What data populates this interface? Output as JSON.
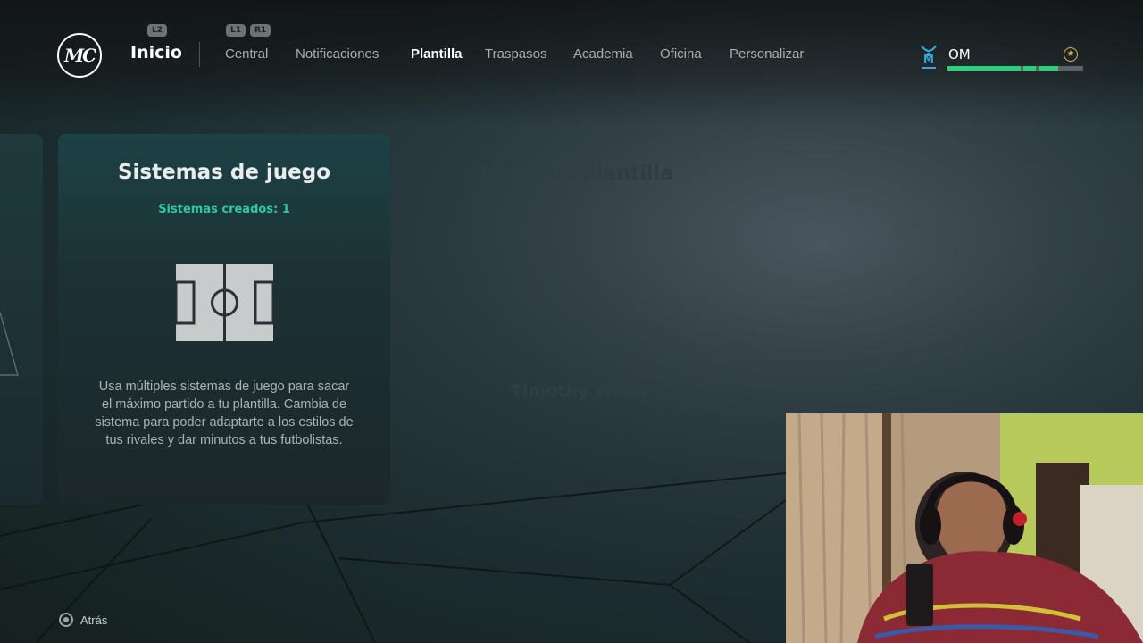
{
  "header": {
    "logo_text": "MC",
    "home_hint": "L2",
    "home_label": "Inicio",
    "tab_hints": [
      "L1",
      "R1"
    ],
    "tabs": [
      {
        "label": "Central",
        "active": false
      },
      {
        "label": "Notificaciones",
        "active": false
      },
      {
        "label": "Plantilla",
        "active": true
      },
      {
        "label": "Traspasos",
        "active": false
      },
      {
        "label": "Academia",
        "active": false
      },
      {
        "label": "Oficina",
        "active": false
      },
      {
        "label": "Personalizar",
        "active": false
      }
    ],
    "club": {
      "name": "OM",
      "crest_icon": "om-crest-icon",
      "progress_segments": 4,
      "progress_filled": 0.82,
      "accent_color": "#29d17a"
    }
  },
  "card": {
    "title": "Sistemas de juego",
    "subtitle": "Sistemas creados: 1",
    "icon": "pitch-icon",
    "description": "Usa múltiples sistemas de juego para sacar el máximo partido a tu plantilla. Cambia de sistema para poder adaptarte a los estilos de tus rivales y dar minutos a tus futbolistas."
  },
  "background_menu": {
    "title": "Menú de plantilla",
    "player_name": "Timothy Weah"
  },
  "footer": {
    "back_icon": "circle-button-icon",
    "back_label": "Atrás"
  },
  "colors": {
    "accent_teal": "#2ec9a4",
    "text_muted": "#a9aeaf"
  }
}
